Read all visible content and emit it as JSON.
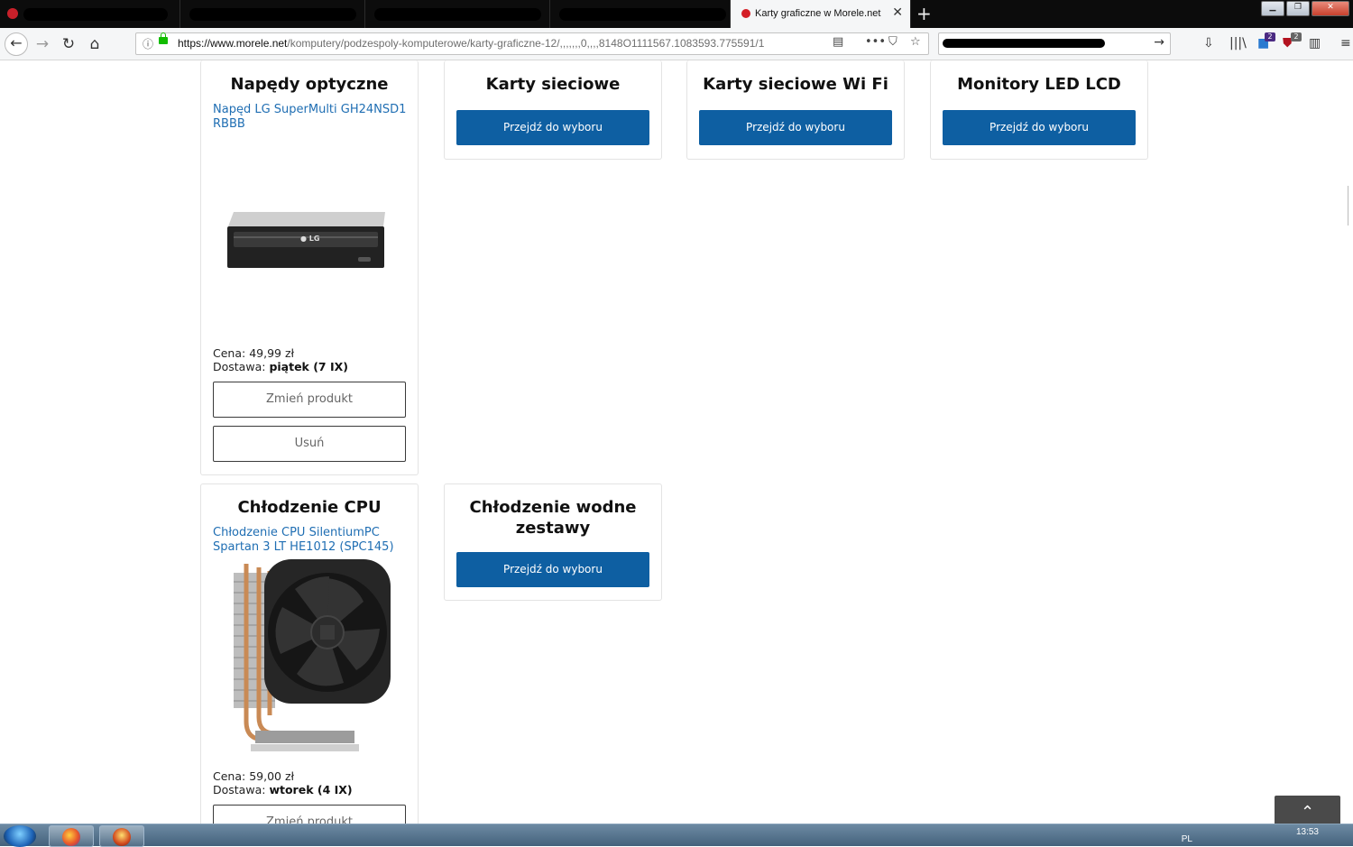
{
  "browser": {
    "active_tab_title": "Karty graficzne w Morele.net",
    "tab_close": "✕",
    "new_tab": "+",
    "url_host": "https://www.morele.net",
    "url_path": "/komputery/podzespoly-komputerowe/karty-graficzne-12/,,,,,,,0,,,,8148O1111567.1083593.775591/1",
    "window_controls": [
      "▁",
      "❐",
      "✕"
    ],
    "badges": [
      "2",
      "2"
    ]
  },
  "cards": {
    "optical": {
      "title": "Napędy optyczne",
      "product": "Napęd LG SuperMulti GH24NSD1 RBBB",
      "price_label": "Cena:",
      "price_value": "49,99 zł",
      "delivery_label": "Dostawa:",
      "delivery_value": "piątek (7 IX)",
      "change_button": "Zmień produkt",
      "remove_button": "Usuń",
      "drive_logo": "● LG"
    },
    "network": {
      "title": "Karty sieciowe",
      "button": "Przejdź do wyboru"
    },
    "wifi": {
      "title": "Karty sieciowe Wi Fi",
      "button": "Przejdź do wyboru"
    },
    "monitors": {
      "title": "Monitory LED LCD",
      "button": "Przejdź do wyboru"
    },
    "cpu_cooling": {
      "title": "Chłodzenie CPU",
      "product": "Chłodzenie CPU SilentiumPC Spartan 3 LT HE1012 (SPC145)",
      "price_label": "Cena:",
      "price_value": "59,00 zł",
      "delivery_label": "Dostawa:",
      "delivery_value": "wtorek (4 IX)",
      "change_button": "Zmień produkt"
    },
    "water_cooling": {
      "title": "Chłodzenie wodne zestawy",
      "button": "Przejdź do wyboru"
    }
  },
  "scroll_top": "⌃",
  "taskbar": {
    "lang": "PL",
    "time": "13:53"
  }
}
